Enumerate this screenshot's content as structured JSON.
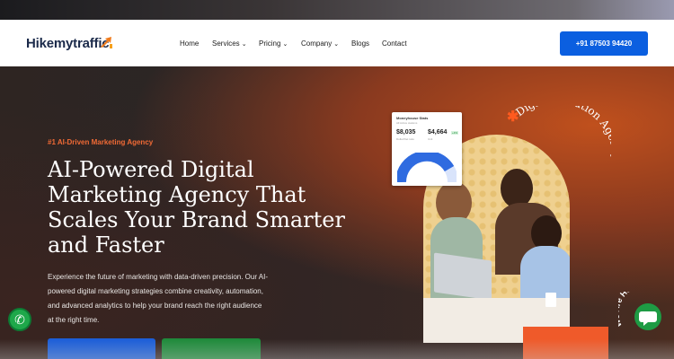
{
  "brand": {
    "name": "Hikemytraffic",
    "accent": "#f07b1c"
  },
  "nav": {
    "items": [
      {
        "label": "Home"
      },
      {
        "label": "Services",
        "dropdown": true
      },
      {
        "label": "Pricing",
        "dropdown": true
      },
      {
        "label": "Company",
        "dropdown": true
      },
      {
        "label": "Blogs"
      },
      {
        "label": "Contact"
      }
    ],
    "phone_label": "+91 87503 94420"
  },
  "hero": {
    "eyebrow": "#1 AI-Driven Marketing Agency",
    "headline_lines": [
      "AI-Powered Digital",
      "Marketing Agency That",
      "Scales Your Brand Smarter",
      "and Faster"
    ],
    "description_lines": [
      "Experience the future of marketing with data-driven precision. Our AI-",
      "powered digital marketing strategies combine creativity, automation,",
      "and advanced analytics to help your brand reach the right audience",
      "at the right time."
    ],
    "arc_text": "Digital Solution Agency"
  },
  "stats_card": {
    "title": "Moneyhouse Stats",
    "subtitle": "All Active stations",
    "value_1": "$8,035",
    "value_2": "$4,664",
    "badge": "+4%",
    "label_1": "Dollar/Net ratio",
    "label_2": "Unit"
  },
  "badge_text": "We Are Here!",
  "colors": {
    "phone_button": "#0b5fe0",
    "eyebrow": "#f06a35",
    "whatsapp": "#1ea84a",
    "cta_orange": "#ef5a2a"
  }
}
